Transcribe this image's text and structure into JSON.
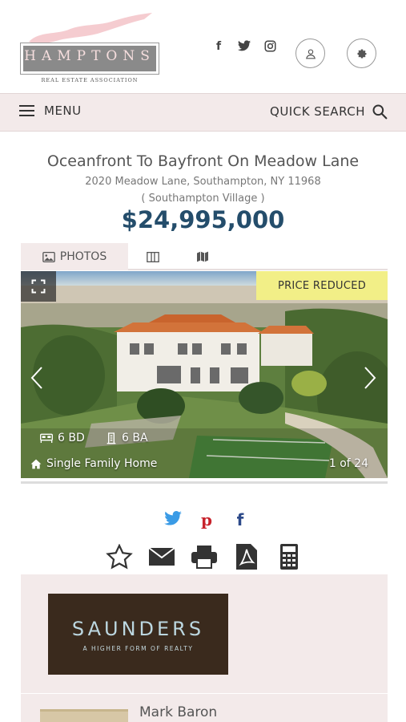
{
  "header": {
    "logo_text": "HAMPTONS",
    "logo_subtitle": "REAL ESTATE ASSOCIATION",
    "social_icons": [
      "facebook-icon",
      "twitter-icon",
      "instagram-icon"
    ],
    "user_icon": "user-icon",
    "settings_icon": "gear-icon"
  },
  "nav": {
    "menu_label": "MENU",
    "quick_search_label": "QUICK SEARCH"
  },
  "listing": {
    "title": "Oceanfront To Bayfront On Meadow Lane",
    "address": "2020 Meadow Lane, Southampton, NY 11968",
    "village": "( Southampton Village )",
    "price": "$24,995,000"
  },
  "tabs": [
    {
      "label": "PHOTOS",
      "icon": "image-icon",
      "active": true
    },
    {
      "label": "",
      "icon": "columns-icon",
      "active": false
    },
    {
      "label": "",
      "icon": "map-icon",
      "active": false
    }
  ],
  "photo": {
    "badge": "PRICE REDUCED",
    "beds": "6 BD",
    "baths": "6 BA",
    "property_type": "Single Family Home",
    "counter": "1 of 24"
  },
  "share_icons": [
    "twitter-icon",
    "pinterest-icon",
    "facebook-icon"
  ],
  "action_icons": [
    "star-icon",
    "envelope-icon",
    "printer-icon",
    "pdf-icon",
    "calculator-icon"
  ],
  "agent": {
    "brokerage_name": "SAUNDERS",
    "brokerage_tagline": "A HIGHER FORM OF REALTY",
    "name": "Mark Baron"
  },
  "colors": {
    "price": "#244d6b",
    "nav_bg": "#f3eaea",
    "badge_bg": "#f2ef87",
    "twitter": "#3a9be6",
    "pinterest": "#c8232c",
    "facebook": "#2d4a8a"
  }
}
